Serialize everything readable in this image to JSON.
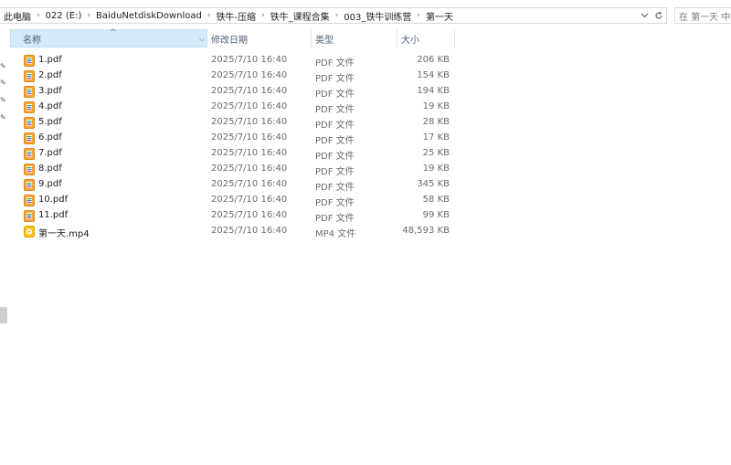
{
  "breadcrumb": [
    {
      "label": "此电脑"
    },
    {
      "label": "022 (E:)"
    },
    {
      "label": "BaiduNetdiskDownload"
    },
    {
      "label": "铁牛-压缩"
    },
    {
      "label": "铁牛_课程合集"
    },
    {
      "label": "003_铁牛训练营"
    },
    {
      "label": "第一天"
    }
  ],
  "search": {
    "placeholder": "在 第一天 中搜"
  },
  "columns": {
    "name": "名称",
    "modified": "修改日期",
    "type": "类型",
    "size": "大小"
  },
  "files": [
    {
      "name": "1.pdf",
      "modified": "2025/7/10 16:40",
      "type": "PDF 文件",
      "size": "206 KB",
      "icon": "pdf-icon"
    },
    {
      "name": "2.pdf",
      "modified": "2025/7/10 16:40",
      "type": "PDF 文件",
      "size": "154 KB",
      "icon": "pdf-icon"
    },
    {
      "name": "3.pdf",
      "modified": "2025/7/10 16:40",
      "type": "PDF 文件",
      "size": "194 KB",
      "icon": "pdf-icon"
    },
    {
      "name": "4.pdf",
      "modified": "2025/7/10 16:40",
      "type": "PDF 文件",
      "size": "19 KB",
      "icon": "pdf-icon"
    },
    {
      "name": "5.pdf",
      "modified": "2025/7/10 16:40",
      "type": "PDF 文件",
      "size": "28 KB",
      "icon": "pdf-icon"
    },
    {
      "name": "6.pdf",
      "modified": "2025/7/10 16:40",
      "type": "PDF 文件",
      "size": "17 KB",
      "icon": "pdf-icon"
    },
    {
      "name": "7.pdf",
      "modified": "2025/7/10 16:40",
      "type": "PDF 文件",
      "size": "25 KB",
      "icon": "pdf-icon"
    },
    {
      "name": "8.pdf",
      "modified": "2025/7/10 16:40",
      "type": "PDF 文件",
      "size": "19 KB",
      "icon": "pdf-icon"
    },
    {
      "name": "9.pdf",
      "modified": "2025/7/10 16:40",
      "type": "PDF 文件",
      "size": "345 KB",
      "icon": "pdf-icon"
    },
    {
      "name": "10.pdf",
      "modified": "2025/7/10 16:40",
      "type": "PDF 文件",
      "size": "58 KB",
      "icon": "pdf-icon"
    },
    {
      "name": "11.pdf",
      "modified": "2025/7/10 16:40",
      "type": "PDF 文件",
      "size": "99 KB",
      "icon": "pdf-icon"
    },
    {
      "name": "第一天.mp4",
      "modified": "2025/7/10 16:40",
      "type": "MP4 文件",
      "size": "48,593 KB",
      "icon": "video-icon"
    }
  ],
  "colors": {
    "header_selected": "#d6e9f7",
    "video_icon": "#f5c518"
  }
}
